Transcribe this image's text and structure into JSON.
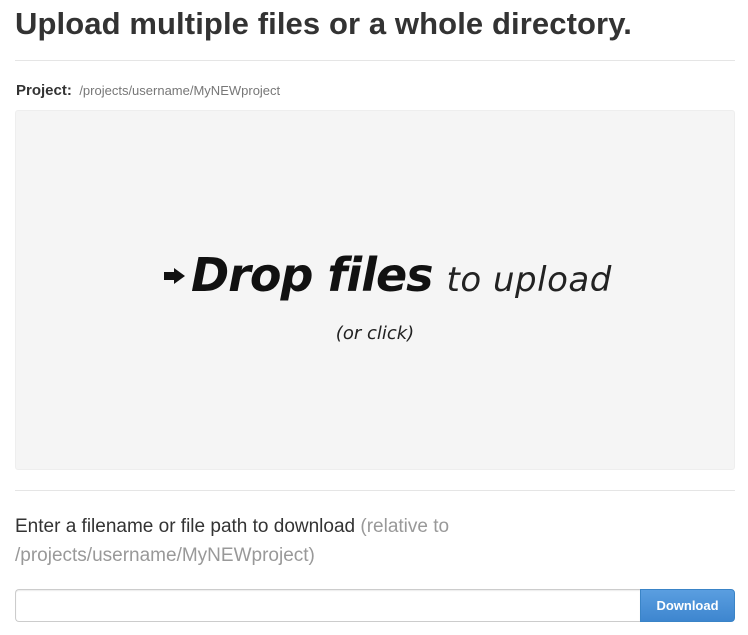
{
  "header": {
    "title": "Upload multiple files or a whole directory."
  },
  "project": {
    "label": "Project:",
    "path": "/projects/username/MyNEWproject"
  },
  "dropzone": {
    "arrow_icon": "arrow-right-icon",
    "strong_text": "Drop files",
    "light_text": "to upload",
    "sub_text": "(or click)"
  },
  "download": {
    "prompt": "Enter a filename or file path to download",
    "hint": "(relative to /projects/username/MyNEWproject)",
    "input_value": "",
    "button_label": "Download",
    "button_color": "#4a90d6"
  }
}
